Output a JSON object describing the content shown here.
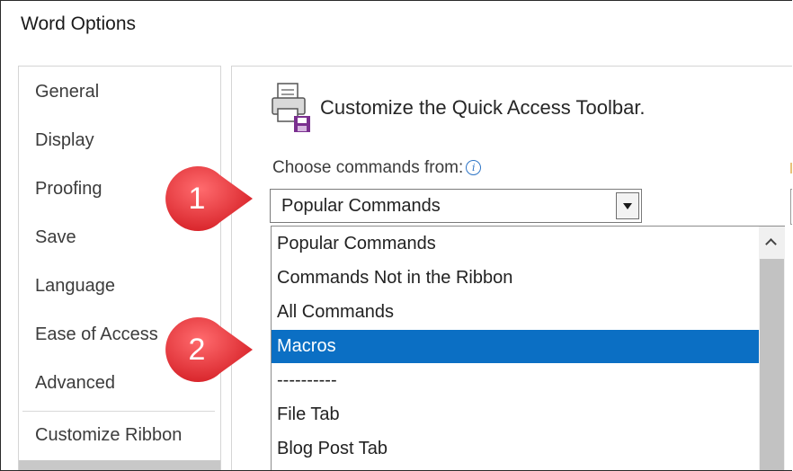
{
  "window": {
    "title": "Word Options"
  },
  "sidebar": {
    "items": [
      {
        "label": "General"
      },
      {
        "label": "Display"
      },
      {
        "label": "Proofing"
      },
      {
        "label": "Save"
      },
      {
        "label": "Language"
      },
      {
        "label": "Ease of Access"
      },
      {
        "label": "Advanced"
      },
      {
        "label": "Customize Ribbon"
      }
    ]
  },
  "main": {
    "icon": "quick-access-toolbar-icon",
    "heading": "Customize the Quick Access Toolbar.",
    "choose_label": "Choose commands from:",
    "info_glyph": "i",
    "combo_value": "Popular Commands",
    "dropdown_options": [
      {
        "label": "Popular Commands",
        "selected": false
      },
      {
        "label": "Commands Not in the Ribbon",
        "selected": false
      },
      {
        "label": "All Commands",
        "selected": false
      },
      {
        "label": "Macros",
        "selected": true
      },
      {
        "label": "----------",
        "selected": false
      },
      {
        "label": "File Tab",
        "selected": false
      },
      {
        "label": "Blog Post Tab",
        "selected": false
      }
    ]
  },
  "callouts": [
    {
      "number": "1"
    },
    {
      "number": "2"
    }
  ],
  "colors": {
    "selection": "#0b6fc4",
    "callout": "#e8353a",
    "info": "#2e75c6"
  }
}
